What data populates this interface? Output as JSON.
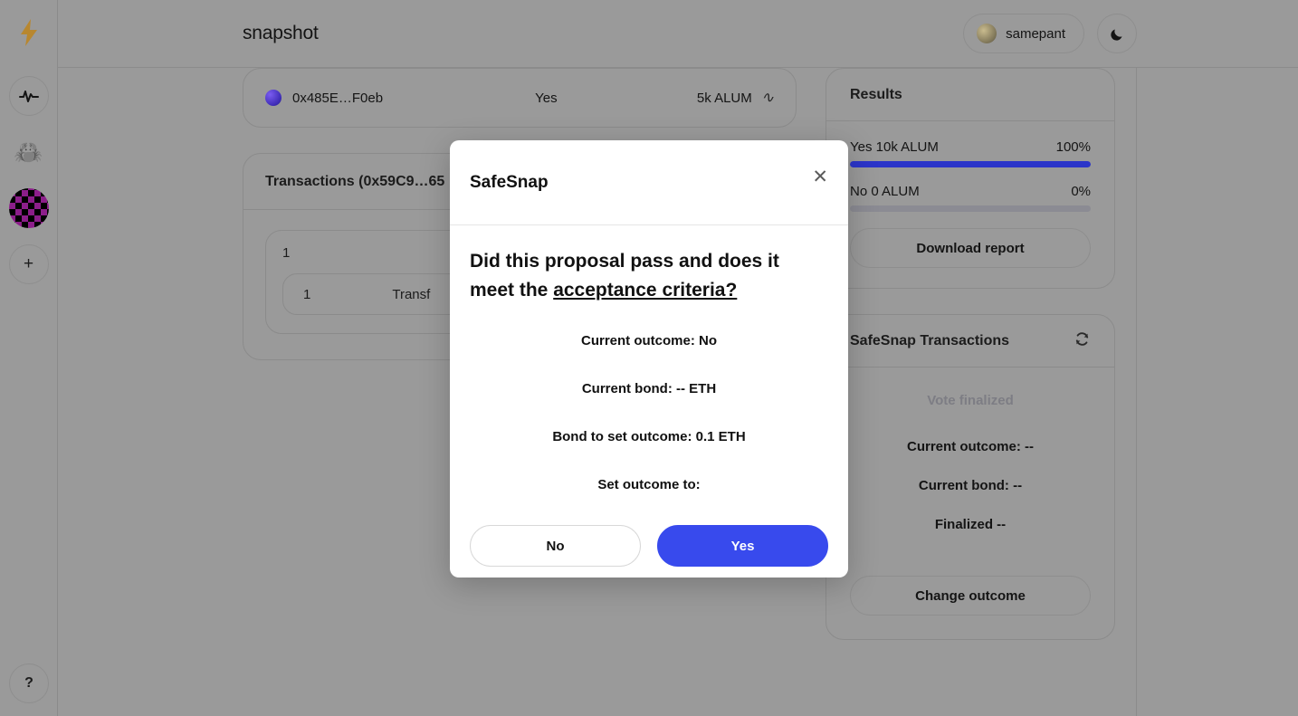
{
  "app": {
    "logo_icon": "lightning-bolt-icon",
    "title": "snapshot"
  },
  "rail": {
    "items": [
      {
        "name": "activity-pulse",
        "icon": "pulse-icon",
        "glyph": "∿"
      },
      {
        "name": "crab-space",
        "icon": "crab-avatar-icon",
        "glyph": "🦀"
      },
      {
        "name": "pixel-space",
        "icon": "pixel-avatar-icon",
        "glyph": ""
      },
      {
        "name": "add-space",
        "icon": "plus-icon",
        "glyph": "+"
      }
    ],
    "help_label": "?"
  },
  "topbar": {
    "user_label": "samepant",
    "user_avatar_icon": "avatar-icon",
    "theme_toggle_icon": "moon-icon",
    "theme_toggle_glyph": "☽"
  },
  "vote_row": {
    "voter": "0x485E…F0eb",
    "choice": "Yes",
    "amount": "5k ALUM",
    "signature_icon": "signature-icon",
    "signature_glyph": "∿"
  },
  "transactions": {
    "header": "Transactions (0x59C9…65",
    "batch_index": "1",
    "item_index": "1",
    "item_label": "Transf"
  },
  "results": {
    "header": "Results",
    "rows": [
      {
        "label": "Yes 10k ALUM",
        "percent_label": "100%",
        "percent": 100
      },
      {
        "label": "No 0 ALUM",
        "percent_label": "0%",
        "percent": 0
      }
    ],
    "download_label": "Download report"
  },
  "safesnap_panel": {
    "header": "SafeSnap Transactions",
    "refresh_icon": "refresh-icon",
    "refresh_glyph": "⟳",
    "status": "Vote finalized",
    "current_outcome": "Current outcome: --",
    "current_bond": "Current bond: --",
    "finalized": "Finalized --",
    "change_outcome_label": "Change outcome"
  },
  "modal": {
    "title": "SafeSnap",
    "close_icon": "close-icon",
    "close_glyph": "✕",
    "question_lead": "Did this proposal pass and does it meet the ",
    "question_link": "acceptance criteria?",
    "current_outcome": "Current outcome: No",
    "current_bond": "Current bond: -- ETH",
    "bond_to_set": "Bond to set outcome: 0.1 ETH",
    "set_outcome_prompt": "Set outcome to:",
    "no_label": "No",
    "yes_label": "Yes"
  },
  "colors": {
    "primary_blue": "#384aed",
    "bar_fill": "#2b35c9",
    "bar_track": "#8b8b93",
    "backdrop": "#9a9a9a",
    "logo_gold": "#b8872f"
  }
}
